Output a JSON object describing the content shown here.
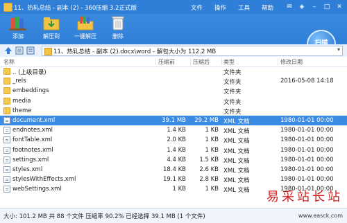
{
  "window": {
    "title": "11、热轧总结 - 副本 (2) - 360压缩 3.2正式版",
    "menus": [
      "文件",
      "操作",
      "工具",
      "帮助"
    ]
  },
  "toolbar": {
    "buttons": [
      {
        "label": "添加",
        "icon": "add-books-icon"
      },
      {
        "label": "解压到",
        "icon": "extract-to-icon"
      },
      {
        "label": "一键解压",
        "icon": "one-click-extract-icon"
      },
      {
        "label": "删除",
        "icon": "trash-icon"
      }
    ],
    "scan_label": "扫描"
  },
  "address": {
    "path": "11、热轧总结 - 副本 (2).docx\\word - 解包大小为 112.2 MB"
  },
  "columns": [
    "名称",
    "压缩前",
    "压缩后",
    "类型",
    "修改日期"
  ],
  "files": [
    {
      "name": ".. (上级目录)",
      "before": "",
      "after": "",
      "type": "文件夹",
      "date": "",
      "kind": "folder"
    },
    {
      "name": "_rels",
      "before": "",
      "after": "",
      "type": "文件夹",
      "date": "2016-05-08 14:18",
      "kind": "folder"
    },
    {
      "name": "embeddings",
      "before": "",
      "after": "",
      "type": "文件夹",
      "date": "",
      "kind": "folder"
    },
    {
      "name": "media",
      "before": "",
      "after": "",
      "type": "文件夹",
      "date": "",
      "kind": "folder"
    },
    {
      "name": "theme",
      "before": "",
      "after": "",
      "type": "文件夹",
      "date": "",
      "kind": "folder"
    },
    {
      "name": "document.xml",
      "before": "39.1 MB",
      "after": "29.2 MB",
      "type": "XML 文档",
      "date": "1980-01-01 00:00",
      "kind": "file",
      "selected": true
    },
    {
      "name": "endnotes.xml",
      "before": "1.4 KB",
      "after": "1 KB",
      "type": "XML 文档",
      "date": "1980-01-01 00:00",
      "kind": "file"
    },
    {
      "name": "fontTable.xml",
      "before": "2.0 KB",
      "after": "1 KB",
      "type": "XML 文档",
      "date": "1980-01-01 00:00",
      "kind": "file"
    },
    {
      "name": "footnotes.xml",
      "before": "1.4 KB",
      "after": "1 KB",
      "type": "XML 文档",
      "date": "1980-01-01 00:00",
      "kind": "file"
    },
    {
      "name": "settings.xml",
      "before": "4.4 KB",
      "after": "1.5 KB",
      "type": "XML 文档",
      "date": "1980-01-01 00:00",
      "kind": "file"
    },
    {
      "name": "styles.xml",
      "before": "18.4 KB",
      "after": "2.6 KB",
      "type": "XML 文档",
      "date": "1980-01-01 00:00",
      "kind": "file"
    },
    {
      "name": "stylesWithEffects.xml",
      "before": "19.1 KB",
      "after": "2.8 KB",
      "type": "XML 文档",
      "date": "1980-01-01 00:00",
      "kind": "file"
    },
    {
      "name": "webSettings.xml",
      "before": "1 KB",
      "after": "1 KB",
      "type": "XML 文档",
      "date": "1980-01-01 00:00",
      "kind": "file"
    }
  ],
  "status": "大小: 101.2 MB 共 88 个文件 压缩率 90.2% 已经选择 39.1 MB (1 个文件)",
  "watermark": {
    "title": "易采站长站",
    "url": "www.easck.com"
  },
  "colors": {
    "title_bg": "#2f7fd8",
    "selection": "#3b8be3"
  }
}
